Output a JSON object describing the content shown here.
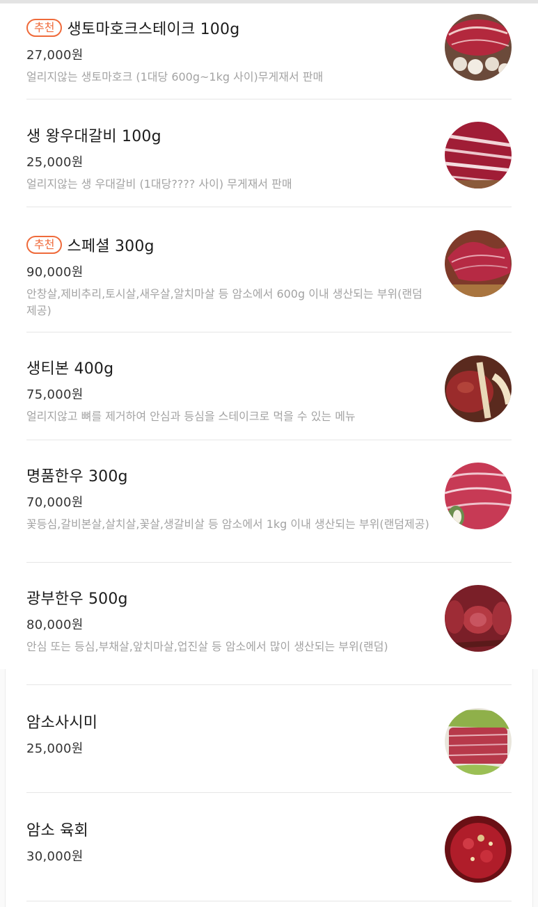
{
  "badge_label": "추천",
  "items": [
    {
      "name": "생토마호크스테이크 100g",
      "price": "27,000원",
      "desc": "얼리지않는 생토마호크 (1대당 600g~1kg 사이)무게재서 판매",
      "recommended": true,
      "image": "tomahawk-steak-photo"
    },
    {
      "name": "생 왕우대갈비 100g",
      "price": "25,000원",
      "desc": "얼리지않는 생 우대갈비 (1대당???? 사이) 무게재서 판매",
      "recommended": false,
      "image": "short-rib-photo"
    },
    {
      "name": "스페셜 300g",
      "price": "90,000원",
      "desc": "안창살,제비추리,토시살,새우살,알치마살 등 암소에서 600g 이내 생산되는 부위(랜덤제공)",
      "recommended": true,
      "image": "special-cuts-photo"
    },
    {
      "name": "생티본 400g",
      "price": "75,000원",
      "desc": "얼리지않고 뼈를 제거하여 안심과 등심을 스테이크로 먹을 수 있는 메뉴",
      "recommended": false,
      "image": "t-bone-photo"
    },
    {
      "name": "명품한우 300g",
      "price": "70,000원",
      "desc": "꽃등심,갈비본살,살치살,꽃살,생갈비살 등 암소에서 1kg 이내 생산되는 부위(랜덤제공)",
      "recommended": false,
      "image": "premium-hanwoo-photo"
    },
    {
      "name": "광부한우 500g",
      "price": "80,000원",
      "desc": "안심 또는 등심,부채살,앞치마살,업진살 등 암소에서 많이 생산되는 부위(랜덤)",
      "recommended": false,
      "image": "miner-hanwoo-photo"
    },
    {
      "name": "암소사시미",
      "price": "25,000원",
      "desc": "",
      "recommended": false,
      "image": "beef-sashimi-photo"
    },
    {
      "name": "암소 육회",
      "price": "30,000원",
      "desc": "",
      "recommended": false,
      "image": "yukhoe-photo"
    }
  ]
}
